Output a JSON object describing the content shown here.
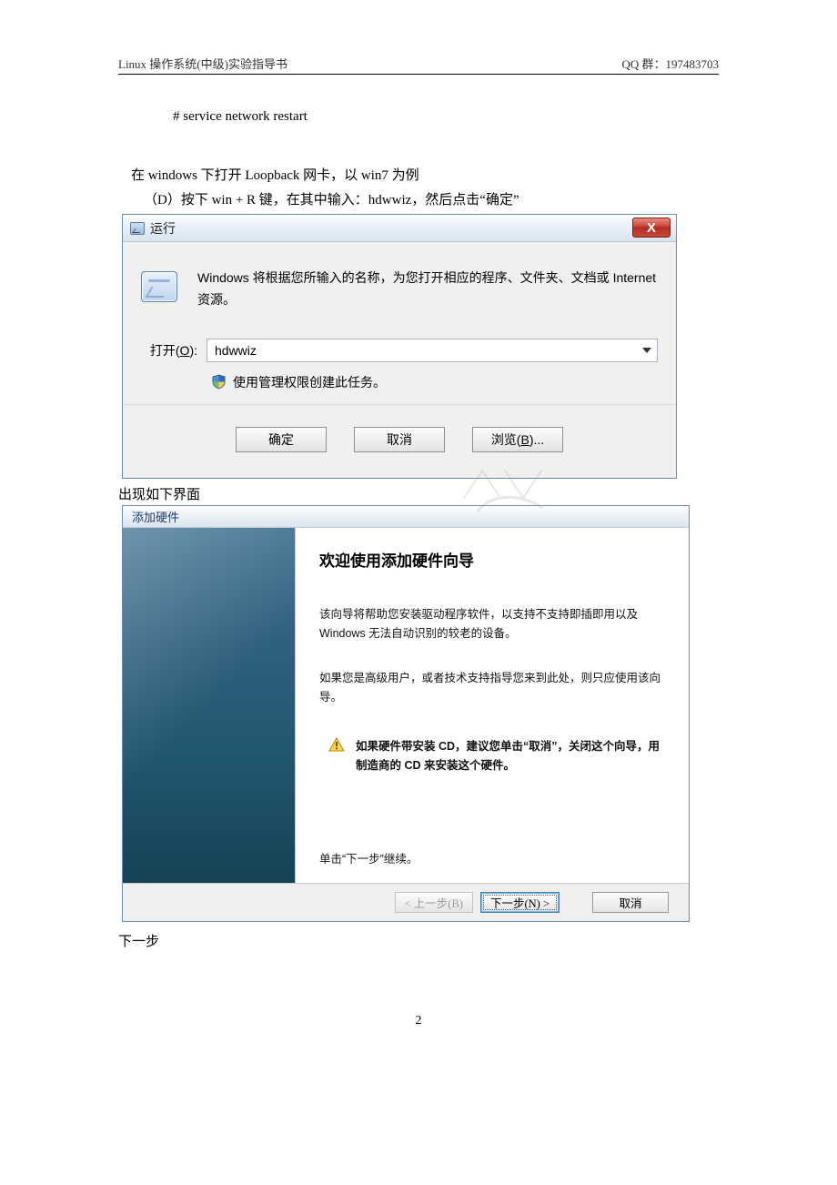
{
  "header": {
    "left": "Linux 操作系统(中级)实验指导书",
    "right": "QQ 群：197483703"
  },
  "commandLine": "# service network restart",
  "intro1": "在 windows 下打开 Loopback 网卡，以 win7 为例",
  "intro2": "（D）按下 win + R 键，在其中输入：hdwwiz，然后点击“确定”",
  "runDialog": {
    "title": "运行",
    "closeGlyph": "X",
    "description": "Windows 将根据您所输入的名称，为您打开相应的程序、文件夹、文档或 Internet 资源。",
    "openLabelPrefix": "打开(",
    "openLabelKey": "O",
    "openLabelSuffix": "):",
    "value": "hdwwiz",
    "adminText": "使用管理权限创建此任务。",
    "buttons": {
      "ok": "确定",
      "cancel": "取消",
      "browsePrefix": "浏览(",
      "browseKey": "B",
      "browseSuffix": ")..."
    }
  },
  "betweenText": "出现如下界面",
  "wizard": {
    "windowTitle": "添加硬件",
    "heading": "欢迎使用添加硬件向导",
    "para1": "该向导将帮助您安装驱动程序软件，以支持不支持即插即用以及 Windows 无法自动识别的较老的设备。",
    "para2": "如果您是高级用户，或者技术支持指导您来到此处，则只应使用该向导。",
    "warning": "如果硬件带安装 CD，建议您单击“取消”，关闭这个向导，用制造商的 CD 来安装这个硬件。",
    "continueText": "单击“下一步”继续。",
    "buttons": {
      "back": "< 上一步(B)",
      "next": "下一步(N) >",
      "cancel": "取消"
    }
  },
  "afterText": "下一步",
  "pageNumber": "2"
}
